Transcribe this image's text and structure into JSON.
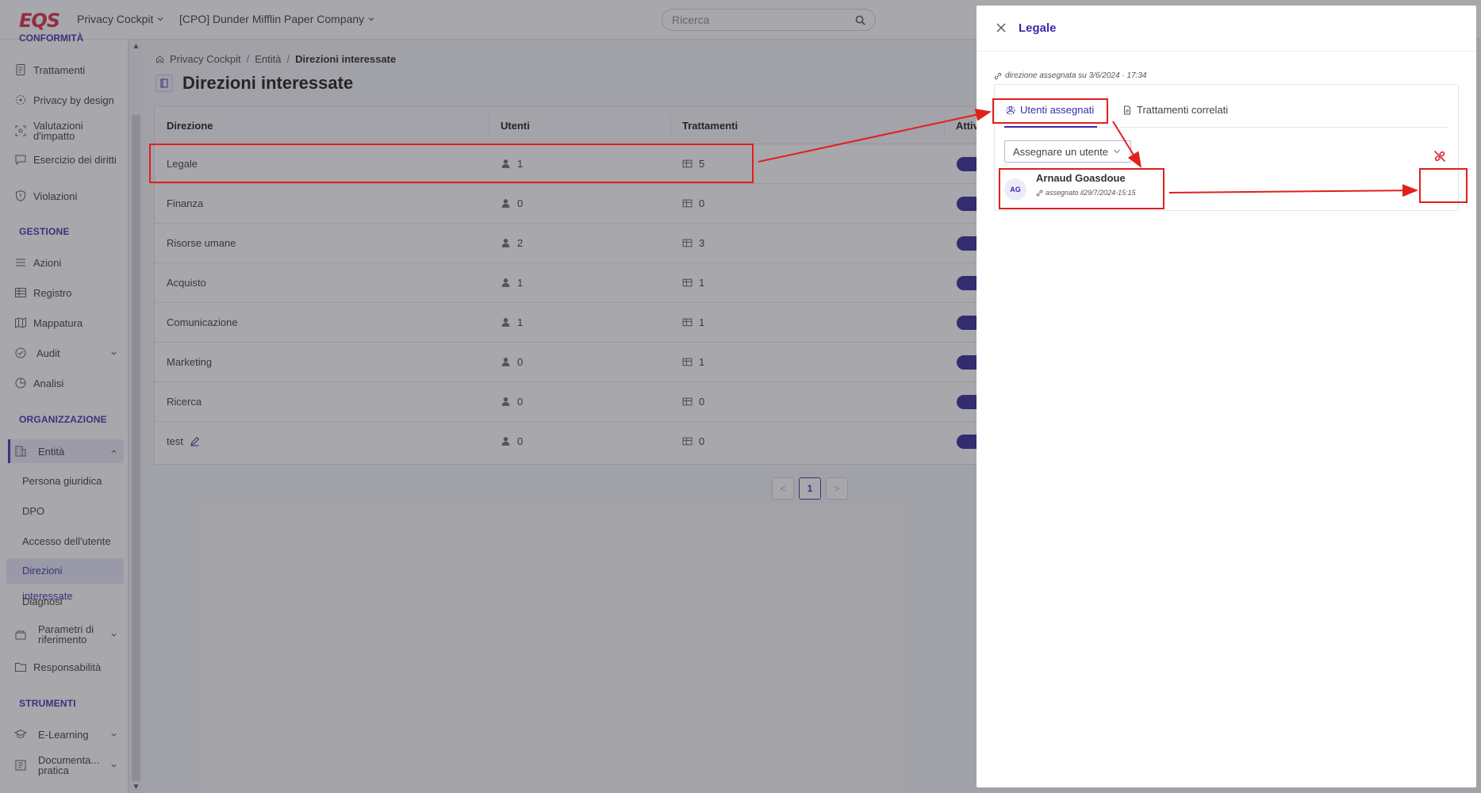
{
  "app": {
    "logo": "EQS",
    "product_menu": "Privacy Cockpit",
    "company_menu": "[CPO] Dunder Mifflin Paper Company",
    "search_placeholder": "Ricerca"
  },
  "sidebar": {
    "cut_section": "CONFORMITÀ",
    "items_top": [
      {
        "label": "Trattamenti",
        "icon": "file-text-icon"
      },
      {
        "label": "Privacy by design",
        "icon": "target-icon"
      },
      {
        "label": "Valutazioni d'impatto",
        "icon": "scan-icon"
      },
      {
        "label": "Esercizio dei diritti",
        "icon": "chat-icon"
      },
      {
        "label": "Violazioni",
        "icon": "shield-icon"
      }
    ],
    "section_gestione": "GESTIONE",
    "items_gestione": [
      {
        "label": "Azioni",
        "icon": "list-icon"
      },
      {
        "label": "Registro",
        "icon": "table-icon"
      },
      {
        "label": "Mappatura",
        "icon": "map-icon"
      },
      {
        "label": "Audit",
        "icon": "check-circle-icon"
      },
      {
        "label": "Analisi",
        "icon": "pie-chart-icon"
      }
    ],
    "section_organizzazione": "ORGANIZZAZIONE",
    "entita_label": "Entità",
    "entita_sub": [
      "Persona giuridica",
      "DPO",
      "Accesso dell'utente",
      "Direzioni interessate",
      "Diagnosi"
    ],
    "active_sub": "Direzioni interessate",
    "parametri_label": "Parametri di riferimento",
    "responsabilita_label": "Responsabilità",
    "section_strumenti": "STRUMENTI",
    "elearning_label": "E-Learning",
    "documentazione_label": "Documenta... pratica"
  },
  "breadcrumb": [
    "Privacy Cockpit",
    "Entità",
    "Direzioni interessate"
  ],
  "page_title": "Direzioni interessate",
  "table": {
    "headers": [
      "Direzione",
      "Utenti",
      "Trattamenti",
      "Attiv"
    ],
    "rows": [
      {
        "name": "Legale",
        "users": "1",
        "treatments": "5"
      },
      {
        "name": "Finanza",
        "users": "0",
        "treatments": "0"
      },
      {
        "name": "Risorse umane",
        "users": "2",
        "treatments": "3"
      },
      {
        "name": "Acquisto",
        "users": "1",
        "treatments": "1"
      },
      {
        "name": "Comunicazione",
        "users": "1",
        "treatments": "1"
      },
      {
        "name": "Marketing",
        "users": "0",
        "treatments": "1"
      },
      {
        "name": "Ricerca",
        "users": "0",
        "treatments": "0"
      },
      {
        "name": "test",
        "users": "0",
        "treatments": "0"
      }
    ]
  },
  "pagination": {
    "current": "1"
  },
  "drawer": {
    "title": "Legale",
    "meta": "direzione assegnata su 3/6/2024 · 17:34",
    "tabs": [
      "Utenti assegnati",
      "Trattamenti correlati"
    ],
    "assign_button": "Assegnare un utente",
    "user": {
      "initials": "AG",
      "name": "Arnaud Goasdoue",
      "assigned": "assegnato il29/7/2024-15:15"
    }
  },
  "colors": {
    "accent": "#3b2aa8",
    "toggle": "#2c1f8f",
    "annotation": "#e0201c",
    "logo": "#d7263d"
  }
}
